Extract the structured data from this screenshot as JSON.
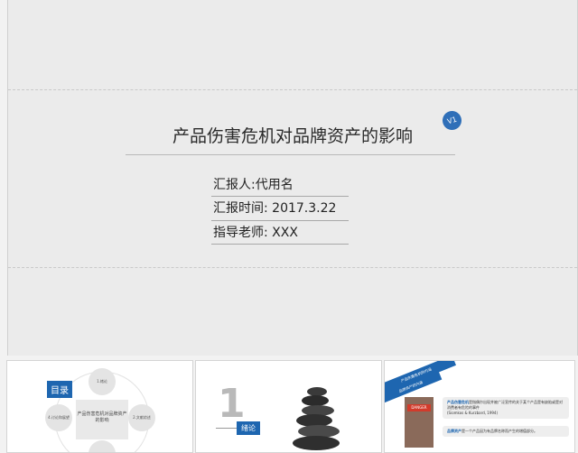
{
  "slide": {
    "badge": "V1",
    "title": "产品伤害危机对品牌资产的影响",
    "info": [
      {
        "text": "汇报人:代用名"
      },
      {
        "text": "汇报时间:   2017.3.22"
      },
      {
        "text": "指导老师:    XXX"
      }
    ]
  },
  "thumbnails": {
    "toc": {
      "label": "目录",
      "center": "产品伤害危机对品牌资产的影响",
      "items": [
        "1.绪论",
        "2.文献综述",
        "4.讨论和展望",
        ""
      ]
    },
    "intro": {
      "number": "1",
      "label": "绪论"
    },
    "definition": {
      "ribbon_top": "产品伤害危机的内涵",
      "ribbon_bottom": "品牌资产的内涵",
      "photo_tag": "DANGER",
      "note1_title": "产品伤害危机",
      "note1_text": "是指偶尔出现并被广泛宣传的关于某个产品是有缺陷或是对消费者有危险的事件",
      "note1_cite": "(Siomkos & Kurzbard, 1994)",
      "note2_title": "品牌资产",
      "note2_text": "是一个产品因为有品牌名称而产生的增值部分。"
    }
  }
}
